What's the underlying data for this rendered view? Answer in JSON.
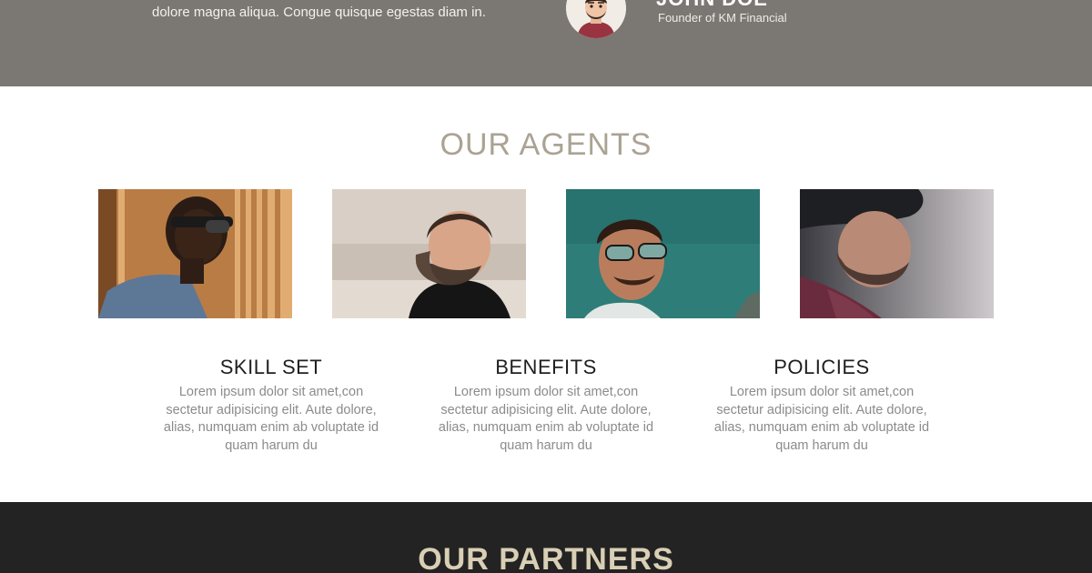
{
  "testimonial": {
    "quote_tail": "dolore magna aliqua. Congue quisque egestas diam in.",
    "person_name": "JOHN DOE",
    "person_role": "Founder of KM Financial"
  },
  "agents": {
    "title": "OUR AGENTS",
    "photos": [
      {
        "alt": "Agent wearing sunglasses against wooden wall"
      },
      {
        "alt": "Bearded agent in black turtleneck"
      },
      {
        "alt": "Agent with mirrored sunglasses"
      },
      {
        "alt": "Bearded agent in beanie and scarf"
      }
    ]
  },
  "features": [
    {
      "title": "SKILL SET",
      "body": "Lorem ipsum dolor sit amet,con sectetur adipisicing elit. Aute dolore, alias, numquam enim ab voluptate id quam harum du"
    },
    {
      "title": "BENEFITS",
      "body": "Lorem ipsum dolor sit amet,con sectetur adipisicing elit. Aute dolore, alias, numquam enim ab voluptate id quam harum du"
    },
    {
      "title": "POLICIES",
      "body": "Lorem ipsum dolor sit amet,con sectetur adipisicing elit. Aute dolore, alias, numquam enim ab voluptate id quam harum du"
    }
  ],
  "partners": {
    "title": "OUR PARTNERS"
  },
  "colors": {
    "testimonial_bg": "#7b7772",
    "accent_title": "#aaa393",
    "partners_bg": "#242323",
    "partners_title": "#d8cfb5"
  }
}
